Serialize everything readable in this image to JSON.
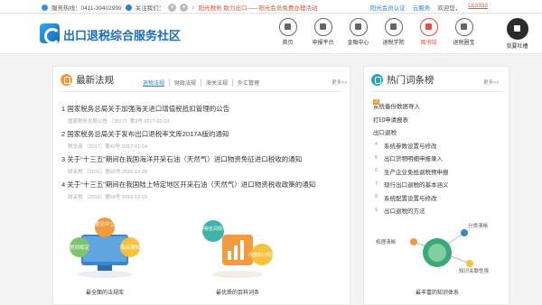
{
  "topbar": {
    "hotline": "服务热线：0411-39402999",
    "follow": "关注我们：",
    "notice": "阳光税务 助力出口——阳光会员免费办理活动",
    "links": [
      "阳光会员认证",
      "云服务",
      "欢迎您，"
    ],
    "username": "Lb3333"
  },
  "header": {
    "brand": "出口退税综合服务社区",
    "nav": [
      {
        "label": "首页"
      },
      {
        "label": "申报平台"
      },
      {
        "label": "金融中心"
      },
      {
        "label": "退税学院"
      },
      {
        "label": "图书馆",
        "active": true
      },
      {
        "label": "退税圈宝"
      },
      {
        "label": "我要吐槽",
        "big": true
      }
    ]
  },
  "news": {
    "title": "最新法规",
    "tabs": [
      "退税法规",
      "财政法规",
      "海关法规",
      "外汇管理"
    ],
    "active_tab": 0,
    "more": "更多>>",
    "items": [
      {
        "n": "1",
        "title": "国家税务总局关于加强海关进口增值税抵扣管理的公告",
        "meta": "国家税务总局公告 〔2017〕第3号    2017-02-13"
      },
      {
        "n": "2",
        "title": "国家税务总局关于发布出口退税率文库2017A版的通知",
        "meta": "税总函 〔2017〕第42号    2017-01-24"
      },
      {
        "n": "3",
        "title": "关于“十三五”期间在我国海洋开采石油（天然气）进口物资免征进口税收的通知",
        "meta": "财关税 〔2016〕第69号    2016-12-29"
      },
      {
        "n": "4",
        "title": "关于“十三五”期间在我国陆上特定地区开采石油（天然气）进口物资税收政策的通知",
        "meta": "财关税 〔2016〕第68号    2016-12-29"
      }
    ]
  },
  "hot": {
    "title": "热门词条榜",
    "more": "更多>>",
    "items": [
      {
        "n": "1",
        "t": "系统备份数据导入"
      },
      {
        "n": "2",
        "t": "打印申请报表"
      },
      {
        "n": "3",
        "t": "出口退税"
      },
      {
        "n": "4",
        "t": "系统参数设置与修改"
      },
      {
        "n": "5",
        "t": "出口货物明细申报录入"
      },
      {
        "n": "6",
        "t": "生产企业免抵退税预申报"
      },
      {
        "n": "7",
        "t": "现行出口退税的基本涵义"
      },
      {
        "n": "8",
        "t": "系统配置设置与修改"
      },
      {
        "n": "9",
        "t": "出口退税的方法"
      }
    ]
  },
  "illustrations": {
    "i1": {
      "caption": "最全面的法规库",
      "words": [
        "意见中立",
        "税则规定",
        "海关通知"
      ]
    },
    "i2": {
      "caption": "最优质的百科词条",
      "words": [
        "退税名词规范",
        "内部出口规范"
      ]
    },
    "i3": {
      "caption": "最丰富的知识体系",
      "words": [
        "分类清晰",
        "梳理清晰",
        "知识关联性强"
      ]
    }
  }
}
